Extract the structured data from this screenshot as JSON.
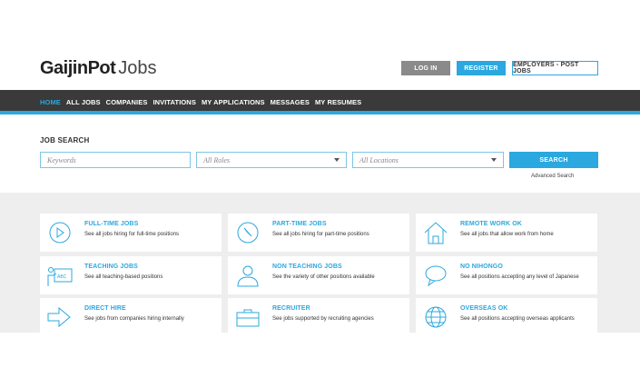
{
  "header": {
    "logo_brand": "GaijinPot",
    "logo_suffix": "Jobs",
    "login_label": "LOG IN",
    "register_label": "REGISTER",
    "employers_label": "EMPLOYERS - POST JOBS"
  },
  "nav": {
    "items": [
      "HOME",
      "ALL JOBS",
      "COMPANIES",
      "INVITATIONS",
      "MY APPLICATIONS",
      "MESSAGES",
      "MY RESUMES"
    ],
    "active": "HOME"
  },
  "search": {
    "title": "JOB SEARCH",
    "keywords_placeholder": "Keywords",
    "roles_value": "All Roles",
    "locations_value": "All Locations",
    "button_label": "SEARCH",
    "advanced_label": "Advanced Search"
  },
  "categories": [
    {
      "title": "FULL-TIME JOBS",
      "desc": "See all jobs hiring for full-time positions",
      "icon": "clock-icon"
    },
    {
      "title": "PART-TIME JOBS",
      "desc": "See all jobs hiring for part-time positions",
      "icon": "clock-icon"
    },
    {
      "title": "REMOTE WORK OK",
      "desc": "See all jobs that allow work from home",
      "icon": "house-icon"
    },
    {
      "title": "TEACHING JOBS",
      "desc": "See all teaching-based positions",
      "icon": "chalkboard-icon"
    },
    {
      "title": "NON TEACHING JOBS",
      "desc": "See the variety of other positions available",
      "icon": "person-icon"
    },
    {
      "title": "NO NIHONGO",
      "desc": "See all positions accepting any level of Japanese",
      "icon": "speech-bubble-icon"
    },
    {
      "title": "DIRECT HIRE",
      "desc": "See jobs from companies hiring internally",
      "icon": "arrow-right-icon"
    },
    {
      "title": "RECRUITER",
      "desc": "See jobs supported by recruiting agencies",
      "icon": "briefcase-icon"
    },
    {
      "title": "OVERSEAS OK",
      "desc": "See all positions accepting overseas applicants",
      "icon": "globe-icon"
    }
  ],
  "colors": {
    "accent": "#2ba8df",
    "nav_bg": "#3a3a3a",
    "login_bg": "#8a8a8a",
    "category_bg": "#eeeeee"
  }
}
